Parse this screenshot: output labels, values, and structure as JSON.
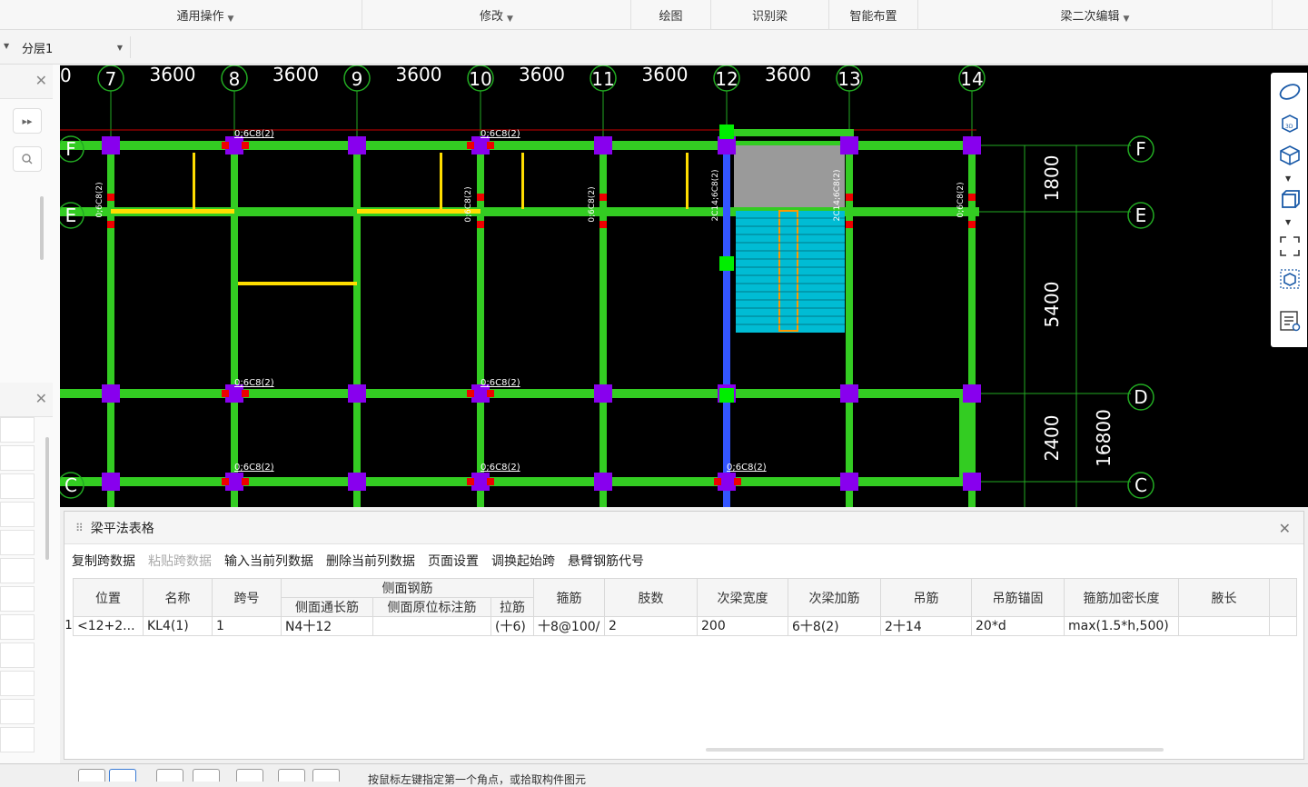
{
  "ribbon": {
    "groups": [
      {
        "label": "通用操作",
        "dropdown": true
      },
      {
        "label": "修改",
        "dropdown": true
      },
      {
        "label": "绘图",
        "dropdown": false
      },
      {
        "label": "识别梁",
        "dropdown": false
      },
      {
        "label": "智能布置",
        "dropdown": false
      },
      {
        "label": "梁二次编辑",
        "dropdown": true
      }
    ]
  },
  "layer_select": {
    "value": "分层1"
  },
  "drawing": {
    "top_axis_numbers": [
      "0",
      "7",
      "8",
      "9",
      "10",
      "11",
      "12",
      "13",
      "14"
    ],
    "top_spacings": [
      "3600",
      "3600",
      "3600",
      "3600",
      "3600",
      "3600"
    ],
    "right_axis_letters": [
      "F",
      "E",
      "D",
      "C"
    ],
    "left_axis_letters": [
      "F",
      "E",
      "C"
    ],
    "right_dims": [
      "1800",
      "5400",
      "2400"
    ],
    "total_dim": "16800",
    "beam_labels": [
      "0;6C8(2)",
      "0;6C8(2)",
      "0;6C8(2)",
      "0;6C8(2)",
      "0;6C8(2)",
      "0;6C8(2)",
      "0;6C8(2)"
    ],
    "vertical_labels": [
      "0;6C8(2)",
      "0;6C8(2)",
      "0;6C8(2)",
      "2C14;6C8(2)",
      "2C14;6C8(2)",
      "0;6C8(2)"
    ]
  },
  "panel": {
    "title": "梁平法表格",
    "toolbar": [
      {
        "label": "复制跨数据",
        "disabled": false
      },
      {
        "label": "粘贴跨数据",
        "disabled": true
      },
      {
        "label": "输入当前列数据",
        "disabled": false
      },
      {
        "label": "删除当前列数据",
        "disabled": false
      },
      {
        "label": "页面设置",
        "disabled": false
      },
      {
        "label": "调换起始跨",
        "disabled": false
      },
      {
        "label": "悬臂钢筋代号",
        "disabled": false
      }
    ],
    "headers": {
      "position": "位置",
      "name": "名称",
      "span": "跨号",
      "side_rebar": "侧面钢筋",
      "side_through": "侧面通长筋",
      "side_inplace": "侧面原位标注筋",
      "tie": "拉筋",
      "stirrup": "箍筋",
      "legs": "肢数",
      "sec_width": "次梁宽度",
      "sec_add": "次梁加筋",
      "hanger": "吊筋",
      "hanger_anchor": "吊筋锚固",
      "stirrup_dense": "箍筋加密长度",
      "haunch": "腋长"
    },
    "rows": [
      {
        "num": "1",
        "position": "<12+2...",
        "name": "KL4(1)",
        "span": "1",
        "side_through": "N4十12",
        "side_inplace": "",
        "tie": "(十6)",
        "stirrup": "十8@100/",
        "legs": "2",
        "sec_width": "200",
        "sec_add": "6十8(2)",
        "hanger": "2十14",
        "hanger_anchor": "20*d",
        "stirrup_dense": "max(1.5*h,500)",
        "haunch": ""
      }
    ]
  },
  "status": {
    "text": "按鼠标左键指定第一个角点，或拾取构件图元"
  },
  "colors": {
    "beam": "#33cc22",
    "column": "#8800ee",
    "axis": "#22aa22",
    "background": "#000000"
  }
}
